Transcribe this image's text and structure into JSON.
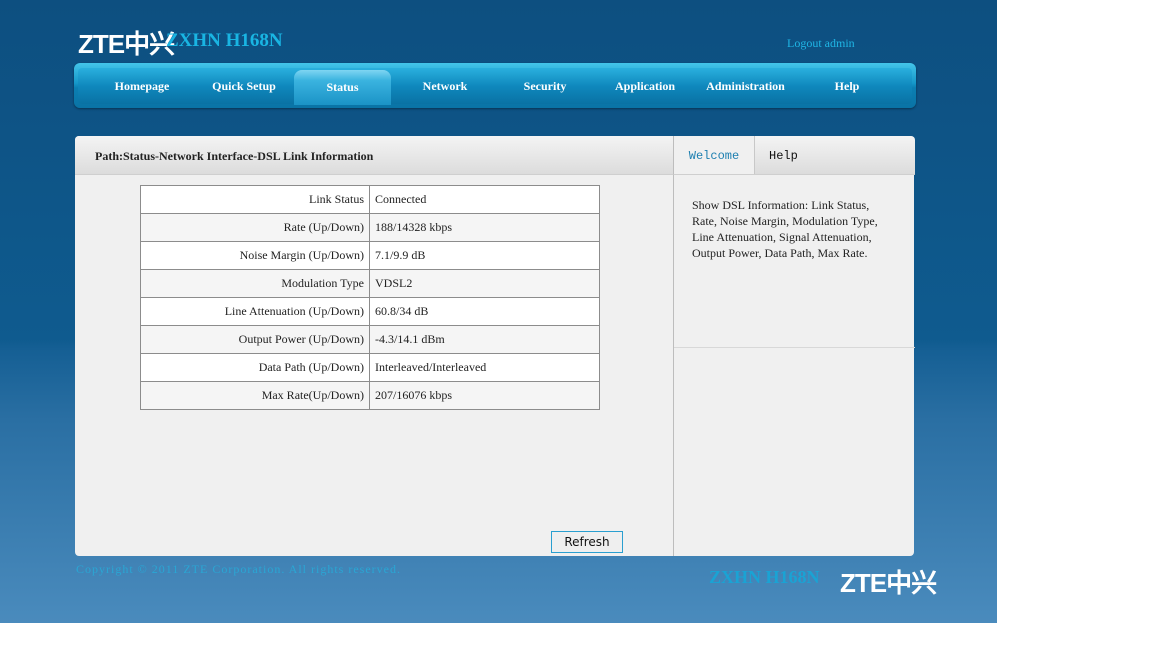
{
  "brand": {
    "logo_text": "ZTE中兴",
    "model": "ZXHN H168N"
  },
  "header": {
    "logout_label": "Logout admin"
  },
  "nav": {
    "items": [
      {
        "label": "Homepage"
      },
      {
        "label": "Quick Setup"
      },
      {
        "label": "Status",
        "active": true
      },
      {
        "label": "Network"
      },
      {
        "label": "Security"
      },
      {
        "label": "Application"
      },
      {
        "label": "Administration"
      },
      {
        "label": "Help"
      }
    ]
  },
  "path": "Path:Status-Network Interface-DSL Link Information",
  "sidebar": {
    "tabs": [
      {
        "label": "Welcome",
        "active": true
      },
      {
        "label": "Help"
      }
    ],
    "help_text": "Show DSL Information: Link Status, Rate, Noise Margin, Modulation Type, Line Attenuation, Signal Attenuation, Output Power, Data Path, Max Rate."
  },
  "dsl_info": {
    "rows": [
      {
        "label": "Link Status",
        "value": "Connected"
      },
      {
        "label": "Rate (Up/Down)",
        "value": "188/14328 kbps"
      },
      {
        "label": "Noise Margin (Up/Down)",
        "value": "7.1/9.9 dB"
      },
      {
        "label": "Modulation Type",
        "value": "VDSL2"
      },
      {
        "label": "Line Attenuation (Up/Down)",
        "value": "60.8/34 dB"
      },
      {
        "label": "Output Power (Up/Down)",
        "value": "-4.3/14.1 dBm"
      },
      {
        "label": "Data Path (Up/Down)",
        "value": "Interleaved/Interleaved"
      },
      {
        "label": "Max Rate(Up/Down)",
        "value": "207/16076 kbps"
      }
    ]
  },
  "actions": {
    "refresh_label": "Refresh"
  },
  "footer": {
    "copyright": "Copyright © 2011 ZTE Corporation. All rights reserved."
  },
  "colors": {
    "nav_blue": "#1597c9",
    "accent_cyan": "#19b5e3",
    "background_blue": "#0f5b8f"
  }
}
